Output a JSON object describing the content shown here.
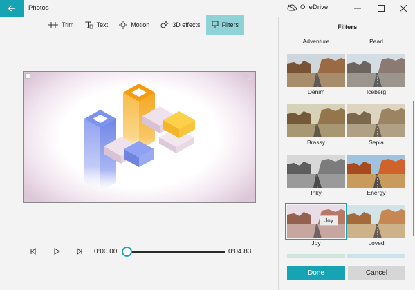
{
  "app": {
    "title": "Photos",
    "account": "OneDrive"
  },
  "toolbar": {
    "items": [
      {
        "label": "Trim",
        "icon": "trim-icon",
        "active": false
      },
      {
        "label": "Text",
        "icon": "text-icon",
        "active": false
      },
      {
        "label": "Motion",
        "icon": "motion-icon",
        "active": false
      },
      {
        "label": "3D effects",
        "icon": "3d-effects-icon",
        "active": false
      },
      {
        "label": "Filters",
        "icon": "filters-icon",
        "active": true
      }
    ]
  },
  "preview": {
    "corner_number": "2"
  },
  "playback": {
    "current_time": "0:00.00",
    "total_time": "0:04.83",
    "progress": 0
  },
  "filters_panel": {
    "title": "Filters",
    "top_labels": [
      "Adventure",
      "Pearl"
    ],
    "filters": [
      {
        "name": "Denim",
        "style": "warm"
      },
      {
        "name": "Iceberg",
        "style": "cool"
      },
      {
        "name": "Brassy",
        "style": "brassy"
      },
      {
        "name": "Sepia",
        "style": "sepia"
      },
      {
        "name": "Inky",
        "style": "bw"
      },
      {
        "name": "Energy",
        "style": "vivid"
      },
      {
        "name": "Joy",
        "style": "joy",
        "selected": true
      },
      {
        "name": "Loved",
        "style": "loved"
      }
    ],
    "tooltip": "Joy",
    "done_label": "Done",
    "cancel_label": "Cancel"
  },
  "colors": {
    "accent": "#16a3b4",
    "selected_tab": "#8fd3d8"
  }
}
